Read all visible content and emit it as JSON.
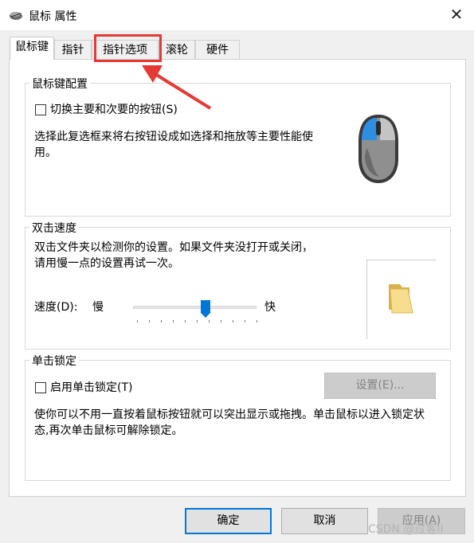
{
  "window": {
    "title": "鼠标 属性",
    "close_glyph": "✕"
  },
  "tabs": [
    {
      "label": "鼠标键"
    },
    {
      "label": "指针"
    },
    {
      "label": "指针选项"
    },
    {
      "label": "滚轮"
    },
    {
      "label": "硬件"
    }
  ],
  "button_config": {
    "legend": "鼠标键配置",
    "switch_checkbox_label": "切换主要和次要的按钮(S)",
    "switch_checked": false,
    "description": "选择此复选框来将右按钮设成如选择和拖放等主要性能使用。"
  },
  "double_click": {
    "legend": "双击速度",
    "description": "双击文件夹以检测你的设置。如果文件夹没打开或关闭，请用慢一点的设置再试一次。",
    "speed_label": "速度(D):",
    "slow_label": "慢",
    "fast_label": "快",
    "speed_level": 0.59
  },
  "click_lock": {
    "legend": "单击锁定",
    "checkbox_label": "启用单击锁定(T)",
    "checked": false,
    "settings_button": "设置(E)...",
    "description": "使你可以不用一直按着鼠标按钮就可以突出显示或拖拽。单击鼠标以进入锁定状态,再次单击鼠标可解除锁定。"
  },
  "footer": {
    "ok": "确定",
    "cancel": "取消",
    "apply": "应用(A)"
  },
  "watermark": "CSDN @过客II",
  "colors": {
    "accent": "#0078d7",
    "annotation": "#e53935"
  }
}
